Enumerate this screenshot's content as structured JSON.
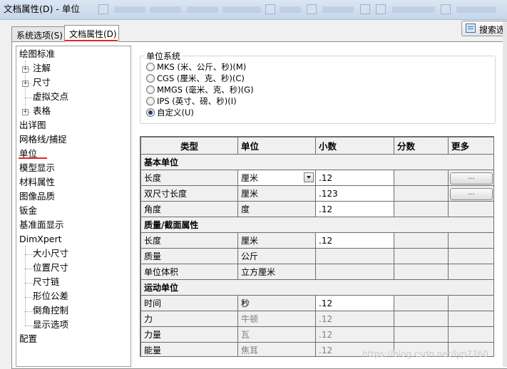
{
  "window": {
    "title": "文档属性(D) - 单位"
  },
  "tabs": [
    {
      "label": "系统选项(S)",
      "active": false
    },
    {
      "label": "文档属性(D)",
      "active": true
    }
  ],
  "search_button": {
    "label": "搜索选项",
    "icon": "search-options-icon"
  },
  "tree": {
    "items": [
      {
        "label": "绘图标准",
        "level": 0,
        "expandable": false
      },
      {
        "label": "注解",
        "level": 1,
        "expandable": true
      },
      {
        "label": "尺寸",
        "level": 1,
        "expandable": true
      },
      {
        "label": "虚拟交点",
        "level": 1,
        "expandable": false
      },
      {
        "label": "表格",
        "level": 1,
        "expandable": true
      },
      {
        "label": "出详图",
        "level": 0,
        "expandable": false
      },
      {
        "label": "网格线/捕捉",
        "level": 0,
        "expandable": false
      },
      {
        "label": "单位",
        "level": 0,
        "expandable": false,
        "selected": true
      },
      {
        "label": "模型显示",
        "level": 0,
        "expandable": false
      },
      {
        "label": "材料属性",
        "level": 0,
        "expandable": false
      },
      {
        "label": "图像品质",
        "level": 0,
        "expandable": false
      },
      {
        "label": "钣金",
        "level": 0,
        "expandable": false
      },
      {
        "label": "基准面显示",
        "level": 0,
        "expandable": false
      },
      {
        "label": "DimXpert",
        "level": 0,
        "expandable": false
      },
      {
        "label": "大小尺寸",
        "level": 1,
        "expandable": false
      },
      {
        "label": "位置尺寸",
        "level": 1,
        "expandable": false
      },
      {
        "label": "尺寸链",
        "level": 1,
        "expandable": false
      },
      {
        "label": "形位公差",
        "level": 1,
        "expandable": false
      },
      {
        "label": "倒角控制",
        "level": 1,
        "expandable": false
      },
      {
        "label": "显示选项",
        "level": 1,
        "expandable": false
      },
      {
        "label": "配置",
        "level": 0,
        "expandable": false
      }
    ]
  },
  "unit_system": {
    "title": "单位系统",
    "options": [
      {
        "label": "MKS (米、公斤、秒)(M)",
        "checked": false
      },
      {
        "label": "CGS (厘米、克、秒)(C)",
        "checked": false
      },
      {
        "label": "MMGS (毫米、克、秒)(G)",
        "checked": false
      },
      {
        "label": "IPS (英寸、磅、秒)(I)",
        "checked": false
      },
      {
        "label": "自定义(U)",
        "checked": true
      }
    ]
  },
  "grid": {
    "headers": {
      "type": "类型",
      "unit": "单位",
      "decimal": "小数",
      "fraction": "分数",
      "more": "更多"
    },
    "more_button_label": "...",
    "sections": [
      {
        "title": "基本单位",
        "rows": [
          {
            "type": "长度",
            "unit": "厘米",
            "decimal": ".12",
            "fraction": "",
            "has_dropdown": true,
            "has_more": true
          },
          {
            "type": "双尺寸长度",
            "unit": "厘米",
            "decimal": ".123",
            "fraction": "",
            "has_dropdown": false,
            "has_more": true
          },
          {
            "type": "角度",
            "unit": "度",
            "decimal": ".12",
            "fraction": "",
            "has_dropdown": false,
            "has_more": false
          }
        ]
      },
      {
        "title": "质量/截面属性",
        "rows": [
          {
            "type": "长度",
            "unit": "厘米",
            "decimal": ".12",
            "fraction": "",
            "has_dropdown": false,
            "has_more": false
          },
          {
            "type": "质量",
            "unit": "公斤",
            "decimal": "",
            "fraction": "",
            "has_dropdown": false,
            "has_more": false
          },
          {
            "type": "单位体积",
            "unit": "立方厘米",
            "decimal": "",
            "fraction": "",
            "has_dropdown": false,
            "has_more": false
          }
        ]
      },
      {
        "title": "运动单位",
        "rows": [
          {
            "type": "时间",
            "unit": "秒",
            "decimal": ".12",
            "fraction": "",
            "has_dropdown": false,
            "has_more": false
          },
          {
            "type": "力",
            "unit": "牛顿",
            "decimal": ".12",
            "fraction": "",
            "has_dropdown": false,
            "has_more": false,
            "muted": true
          },
          {
            "type": "力量",
            "unit": "瓦",
            "decimal": ".12",
            "fraction": "",
            "has_dropdown": false,
            "has_more": false,
            "muted": true
          },
          {
            "type": "能量",
            "unit": "焦耳",
            "decimal": ".12",
            "fraction": "",
            "has_dropdown": false,
            "has_more": false,
            "muted": true
          }
        ]
      }
    ]
  },
  "watermark": "https://blog.csdn.net/lyp7760"
}
